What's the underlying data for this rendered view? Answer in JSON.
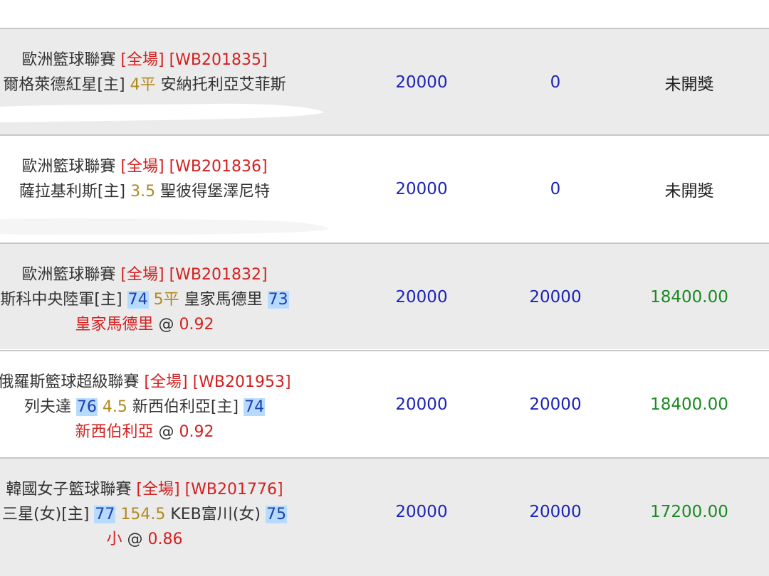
{
  "rows": [
    {
      "league": "歐洲籃球聯賽",
      "period": "[全場]",
      "code": "[WB201835]",
      "home": "爾格萊德紅星[主]",
      "line": "4平",
      "away": "安納托利亞艾菲斯",
      "stake": "20000",
      "win_amount": "0",
      "result": "未開獎"
    },
    {
      "league": "歐洲籃球聯賽",
      "period": "[全場]",
      "code": "[WB201836]",
      "home": "薩拉基利斯[主]",
      "line": "3.5",
      "away": "聖彼得堡澤尼特",
      "stake": "20000",
      "win_amount": "0",
      "result": "未開獎"
    },
    {
      "league": "歐洲籃球聯賽",
      "period": "[全場]",
      "code": "[WB201832]",
      "home": "斯科中央陸軍[主]",
      "home_score": "74",
      "line": "5平",
      "away": "皇家馬德里",
      "away_score": "73",
      "pick": "皇家馬德里",
      "at": "@",
      "odds": "0.92",
      "stake": "20000",
      "win_amount": "20000",
      "result": "18400.00"
    },
    {
      "league": "俄羅斯籃球超級聯賽",
      "period": "[全場]",
      "code": "[WB201953]",
      "home": "列夫達",
      "home_score": "76",
      "line": "4.5",
      "away": "新西伯利亞[主]",
      "away_score": "74",
      "pick": "新西伯利亞",
      "at": "@",
      "odds": "0.92",
      "stake": "20000",
      "win_amount": "20000",
      "result": "18400.00"
    },
    {
      "league": "韓國女子籃球聯賽",
      "period": "[全場]",
      "code": "[WB201776]",
      "home": "三星(女)[主]",
      "home_score": "77",
      "line": "154.5",
      "away": "KEB富川(女)",
      "away_score": "75",
      "pick": "小",
      "at": "@",
      "odds": "0.86",
      "stake": "20000",
      "win_amount": "20000",
      "result": "17200.00"
    }
  ],
  "colors": {
    "row_gray": "#ebebeb",
    "amount_blue": "#1c24b8",
    "result_green": "#1a8a22",
    "highlight": "#b7dbff",
    "red": "#d42020",
    "gold": "#b08a20"
  }
}
